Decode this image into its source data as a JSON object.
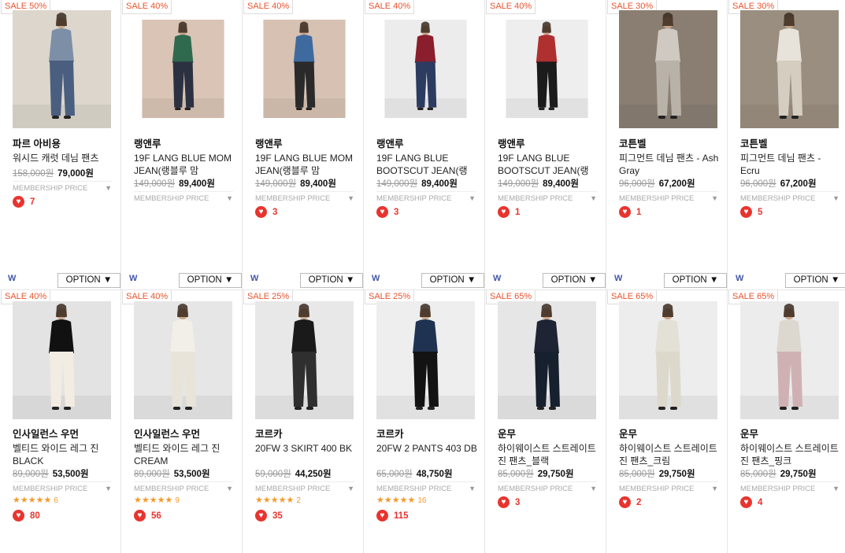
{
  "option_label": "OPTION",
  "option_arrow": "▼",
  "membership_label": "MEMBERSHIP PRICE",
  "membership_arrow": "▼",
  "wmark": "W",
  "row1": [
    {
      "badge": "SALE 50%",
      "brand": "파르 아비용",
      "name": "워시드 캐럿 데님 팬츠",
      "orig": "158,000원",
      "price": "79,000원",
      "likes": "7",
      "stars": "",
      "reviews": ""
    },
    {
      "badge": "SALE 40%",
      "brand": "랭앤루",
      "name": "19F LANG BLUE MOM JEAN(랭블루 맘",
      "orig": "149,000원",
      "price": "89,400원",
      "likes": "",
      "stars": "",
      "reviews": ""
    },
    {
      "badge": "SALE 40%",
      "brand": "랭앤루",
      "name": "19F LANG BLUE MOM JEAN(랭블루 맘",
      "orig": "149,000원",
      "price": "89,400원",
      "likes": "3",
      "stars": "",
      "reviews": ""
    },
    {
      "badge": "SALE 40%",
      "brand": "랭앤루",
      "name": "19F LANG BLUE BOOTSCUT JEAN(랭",
      "orig": "149,000원",
      "price": "89,400원",
      "likes": "3",
      "stars": "",
      "reviews": ""
    },
    {
      "badge": "SALE 40%",
      "brand": "랭앤루",
      "name": "19F LANG BLUE BOOTSCUT JEAN(랭",
      "orig": "149,000원",
      "price": "89,400원",
      "likes": "1",
      "stars": "",
      "reviews": ""
    },
    {
      "badge": "SALE 30%",
      "brand": "코튼벨",
      "name": "피그먼트 데님 팬츠 - Ash Gray",
      "orig": "96,000원",
      "price": "67,200원",
      "likes": "1",
      "stars": "",
      "reviews": ""
    },
    {
      "badge": "SALE 30%",
      "brand": "코튼벨",
      "name": "피그먼트 데님 팬츠 - Ecru",
      "orig": "96,000원",
      "price": "67,200원",
      "likes": "5",
      "stars": "",
      "reviews": ""
    }
  ],
  "row2": [
    {
      "badge": "SALE 40%",
      "brand": "인사일런스 우먼",
      "name": "벨티드 와이드 레그 진 BLACK",
      "orig": "89,000원",
      "price": "53,500원",
      "likes": "80",
      "stars": "★★★★★",
      "reviews": "6"
    },
    {
      "badge": "SALE 40%",
      "brand": "인사일런스 우먼",
      "name": "벨티드 와이드 레그 진 CREAM",
      "orig": "89,000원",
      "price": "53,500원",
      "likes": "56",
      "stars": "★★★★★",
      "reviews": "9"
    },
    {
      "badge": "SALE 25%",
      "brand": "코르카",
      "name": "20FW 3 SKIRT 400 BK",
      "orig": "59,000원",
      "price": "44,250원",
      "likes": "35",
      "stars": "★★★★★",
      "reviews": "2"
    },
    {
      "badge": "SALE 25%",
      "brand": "코르카",
      "name": "20FW 2 PANTS 403 DB",
      "orig": "65,000원",
      "price": "48,750원",
      "likes": "115",
      "stars": "★★★★★",
      "reviews": "16"
    },
    {
      "badge": "SALE 65%",
      "brand": "운무",
      "name": "하이웨이스트 스트레이트 진 팬츠_블랙",
      "orig": "85,000원",
      "price": "29,750원",
      "likes": "3",
      "stars": "",
      "reviews": ""
    },
    {
      "badge": "SALE 65%",
      "brand": "운무",
      "name": "하이웨이스트 스트레이트 진 팬츠_크림",
      "orig": "85,000원",
      "price": "29,750원",
      "likes": "2",
      "stars": "",
      "reviews": ""
    },
    {
      "badge": "SALE 65%",
      "brand": "운무",
      "name": "하이웨이스트 스트레이트 진 팬츠_핑크",
      "orig": "85,000원",
      "price": "29,750원",
      "likes": "4",
      "stars": "",
      "reviews": ""
    }
  ],
  "colors": {
    "sale_accent": "#e8542f",
    "heart": "#e8342f",
    "star": "#f39a2d",
    "link_blue": "#4457a6"
  }
}
